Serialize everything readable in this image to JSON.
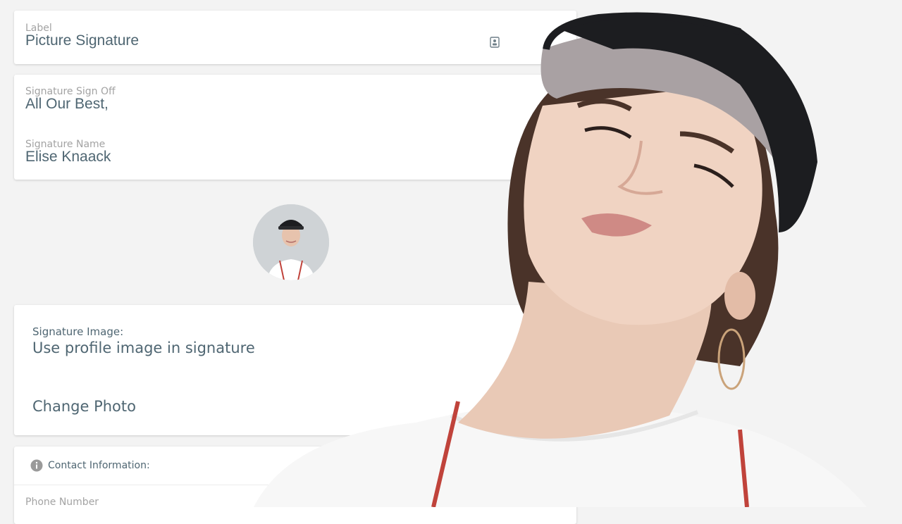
{
  "label_card": {
    "caption": "Label",
    "value": "Picture Signature",
    "icon": "contact-card-icon"
  },
  "signature_card": {
    "sign_off_caption": "Signature Sign Off",
    "sign_off_value": "All Our Best,",
    "name_caption": "Signature Name",
    "name_value": "Elise Knaack"
  },
  "image_card": {
    "caption": "Signature Image:",
    "option_text": "Use profile image in signature",
    "change_photo": "Change Photo"
  },
  "contact_card": {
    "title": "Contact Information:",
    "icon": "info-icon",
    "phone_caption": "Phone Number"
  },
  "colors": {
    "background": "#f3f3f3",
    "card": "#ffffff",
    "text_primary": "#4f6672",
    "text_caption": "#a3a3a3",
    "cap": "#1c1d20",
    "cap_underbrim": "#a9a1a3",
    "shirt": "#f7f7f7"
  }
}
